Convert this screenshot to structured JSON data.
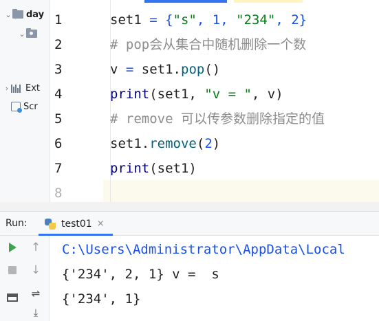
{
  "project": {
    "items": [
      {
        "label": "day",
        "icon": "folder-icon",
        "expanded": true
      },
      {
        "label": "",
        "icon": "package-folder-icon",
        "expanded": true
      },
      {
        "label": "Ext",
        "icon": "external-libraries-icon",
        "expanded": false
      },
      {
        "label": "Scr",
        "icon": "scratches-icon",
        "expanded": false
      }
    ]
  },
  "editor": {
    "line_numbers": [
      "1",
      "2",
      "3",
      "4",
      "5",
      "6",
      "7",
      "8"
    ],
    "lines": [
      [
        {
          "t": "set1",
          "c": "var"
        },
        {
          "t": " = ",
          "c": "op"
        },
        {
          "t": "{",
          "c": "brace"
        },
        {
          "t": "\"s\"",
          "c": "str"
        },
        {
          "t": ", ",
          "c": "op"
        },
        {
          "t": "1",
          "c": "num"
        },
        {
          "t": ", ",
          "c": "op"
        },
        {
          "t": "\"234\"",
          "c": "str"
        },
        {
          "t": ", ",
          "c": "op"
        },
        {
          "t": "2",
          "c": "num"
        },
        {
          "t": "}",
          "c": "brace"
        }
      ],
      [
        {
          "t": "# pop会从集合中随机删除一个数",
          "c": "com"
        }
      ],
      [
        {
          "t": "v",
          "c": "var"
        },
        {
          "t": " = ",
          "c": "op"
        },
        {
          "t": "set1",
          "c": "var"
        },
        {
          "t": ".",
          "c": "par"
        },
        {
          "t": "pop",
          "c": "meth"
        },
        {
          "t": "()",
          "c": "par"
        }
      ],
      [
        {
          "t": "print",
          "c": "fn"
        },
        {
          "t": "(set1, ",
          "c": "par"
        },
        {
          "t": "\"v = \"",
          "c": "str"
        },
        {
          "t": ", v)",
          "c": "par"
        }
      ],
      [
        {
          "t": "# remove 可以传参数删除指定的值",
          "c": "com"
        }
      ],
      [
        {
          "t": "set1",
          "c": "var"
        },
        {
          "t": ".",
          "c": "par"
        },
        {
          "t": "remove",
          "c": "meth"
        },
        {
          "t": "(",
          "c": "par"
        },
        {
          "t": "2",
          "c": "num"
        },
        {
          "t": ")",
          "c": "par"
        }
      ],
      [
        {
          "t": "print",
          "c": "fn"
        },
        {
          "t": "(set1)",
          "c": "par"
        }
      ]
    ]
  },
  "run": {
    "label": "Run:",
    "tab_name": "test01",
    "tab_close": "×",
    "tools": [
      {
        "name": "rerun-icon",
        "enabled": true
      },
      {
        "name": "stop-icon",
        "enabled": false
      },
      {
        "name": "layout-icon",
        "enabled": true
      },
      {
        "name": "scroll-up-icon",
        "enabled": false
      },
      {
        "name": "scroll-down-icon",
        "enabled": false
      },
      {
        "name": "soft-wrap-icon",
        "enabled": true
      },
      {
        "name": "scroll-to-end-icon",
        "enabled": true
      }
    ],
    "output": [
      "C:\\Users\\Administrator\\AppData\\Local",
      "{'234', 2, 1} v =  s",
      "{'234', 1}"
    ]
  },
  "colors": {
    "accent": "#3574f0",
    "run_green": "#3fa34d",
    "string": "#067d17",
    "number": "#1750eb",
    "comment": "#8c8c8c"
  }
}
